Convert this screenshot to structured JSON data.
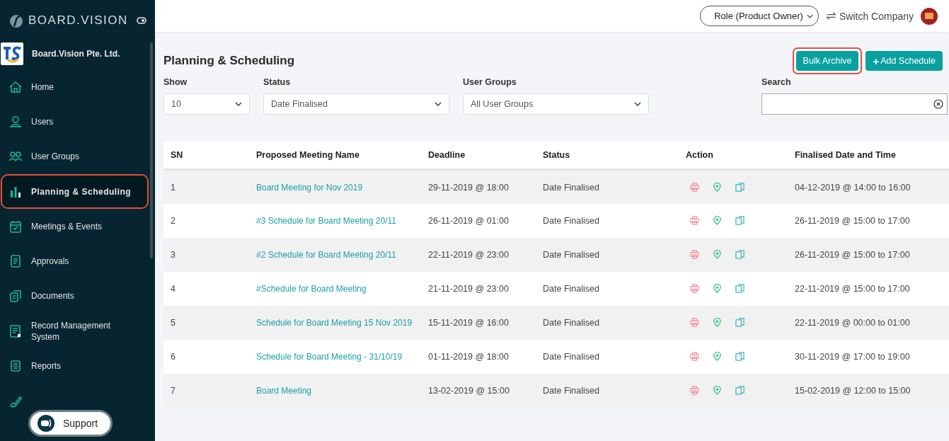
{
  "sidebar": {
    "brand": "BOARD.VISION",
    "company": "Board.Vision Pte. Ltd.",
    "items": [
      {
        "label": "Home",
        "kind": "home",
        "selected": false,
        "highlighted": false
      },
      {
        "label": "Users",
        "kind": "user",
        "selected": false,
        "highlighted": false
      },
      {
        "label": "User Groups",
        "kind": "users",
        "selected": false,
        "highlighted": false
      },
      {
        "label": "Planning & Scheduling",
        "kind": "bars",
        "selected": true,
        "highlighted": true
      },
      {
        "label": "Meetings & Events",
        "kind": "calendar",
        "selected": false,
        "highlighted": false
      },
      {
        "label": "Approvals",
        "kind": "doc",
        "selected": false,
        "highlighted": false
      },
      {
        "label": "Documents",
        "kind": "docs",
        "selected": false,
        "highlighted": false
      },
      {
        "label": "Record Management System",
        "kind": "record",
        "selected": false,
        "highlighted": false
      },
      {
        "label": "Reports",
        "kind": "list",
        "selected": false,
        "highlighted": false
      },
      {
        "kind": "pen",
        "selected": false,
        "highlighted": false
      }
    ],
    "support": "Support"
  },
  "topbar": {
    "role": "Role (Product Owner)",
    "switch": "Switch Company"
  },
  "page": {
    "title": "Planning & Scheduling",
    "buttons": [
      {
        "label": "Bulk Archive",
        "kind": "plain",
        "highlighted": true
      },
      {
        "label": "Add Schedule",
        "kind": "add",
        "icon": "+",
        "highlighted": false
      }
    ],
    "filters": [
      {
        "label": "Show",
        "value": "10"
      },
      {
        "label": "Status",
        "value": "Date Finalised"
      },
      {
        "label": "User Groups",
        "value": "All User Groups"
      }
    ],
    "search": {
      "label": "Search"
    }
  },
  "table": {
    "columns": [
      "SN",
      "Proposed Meeting Name",
      "Deadline",
      "Status",
      "Action",
      "Finalised Date and Time"
    ],
    "rows": [
      {
        "sn": "1",
        "name": "Board Meeting for Nov 2019",
        "deadline": "29-11-2019 @ 18:00",
        "status": "Date Finalised",
        "finalised": "04-12-2019 @ 14:00 to 16:00"
      },
      {
        "sn": "2",
        "name": "#3 Schedule for Board Meeting 20/11",
        "deadline": "26-11-2019 @ 01:00",
        "status": "Date Finalised",
        "finalised": "26-11-2019 @ 15:00 to 17:00"
      },
      {
        "sn": "3",
        "name": "#2 Schedule for Board Meeting 20/11",
        "deadline": "22-11-2019 @ 23:00",
        "status": "Date Finalised",
        "finalised": "26-11-2019 @ 15:00 to 17:00"
      },
      {
        "sn": "4",
        "name": "#Schedule for Board Meeting",
        "deadline": "21-11-2019 @ 23:00",
        "status": "Date Finalised",
        "finalised": "22-11-2019 @ 15:00 to 17:00"
      },
      {
        "sn": "5",
        "name": "Schedule for Board Meeting 15 Nov 2019",
        "deadline": "15-11-2019 @ 16:00",
        "status": "Date Finalised",
        "finalised": "22-11-2019 @ 00:00 to 01:00"
      },
      {
        "sn": "6",
        "name": "Schedule for Board Meeting - 31/10/19",
        "deadline": "01-11-2019 @ 18:00",
        "status": "Date Finalised",
        "finalised": "30-11-2019 @ 17:00 to 19:00"
      },
      {
        "sn": "7",
        "name": "Board Meeting",
        "deadline": "13-02-2019 @ 15:00",
        "status": "Date Finalised",
        "finalised": "15-02-2019 @ 12:00 to 15:00"
      }
    ]
  }
}
